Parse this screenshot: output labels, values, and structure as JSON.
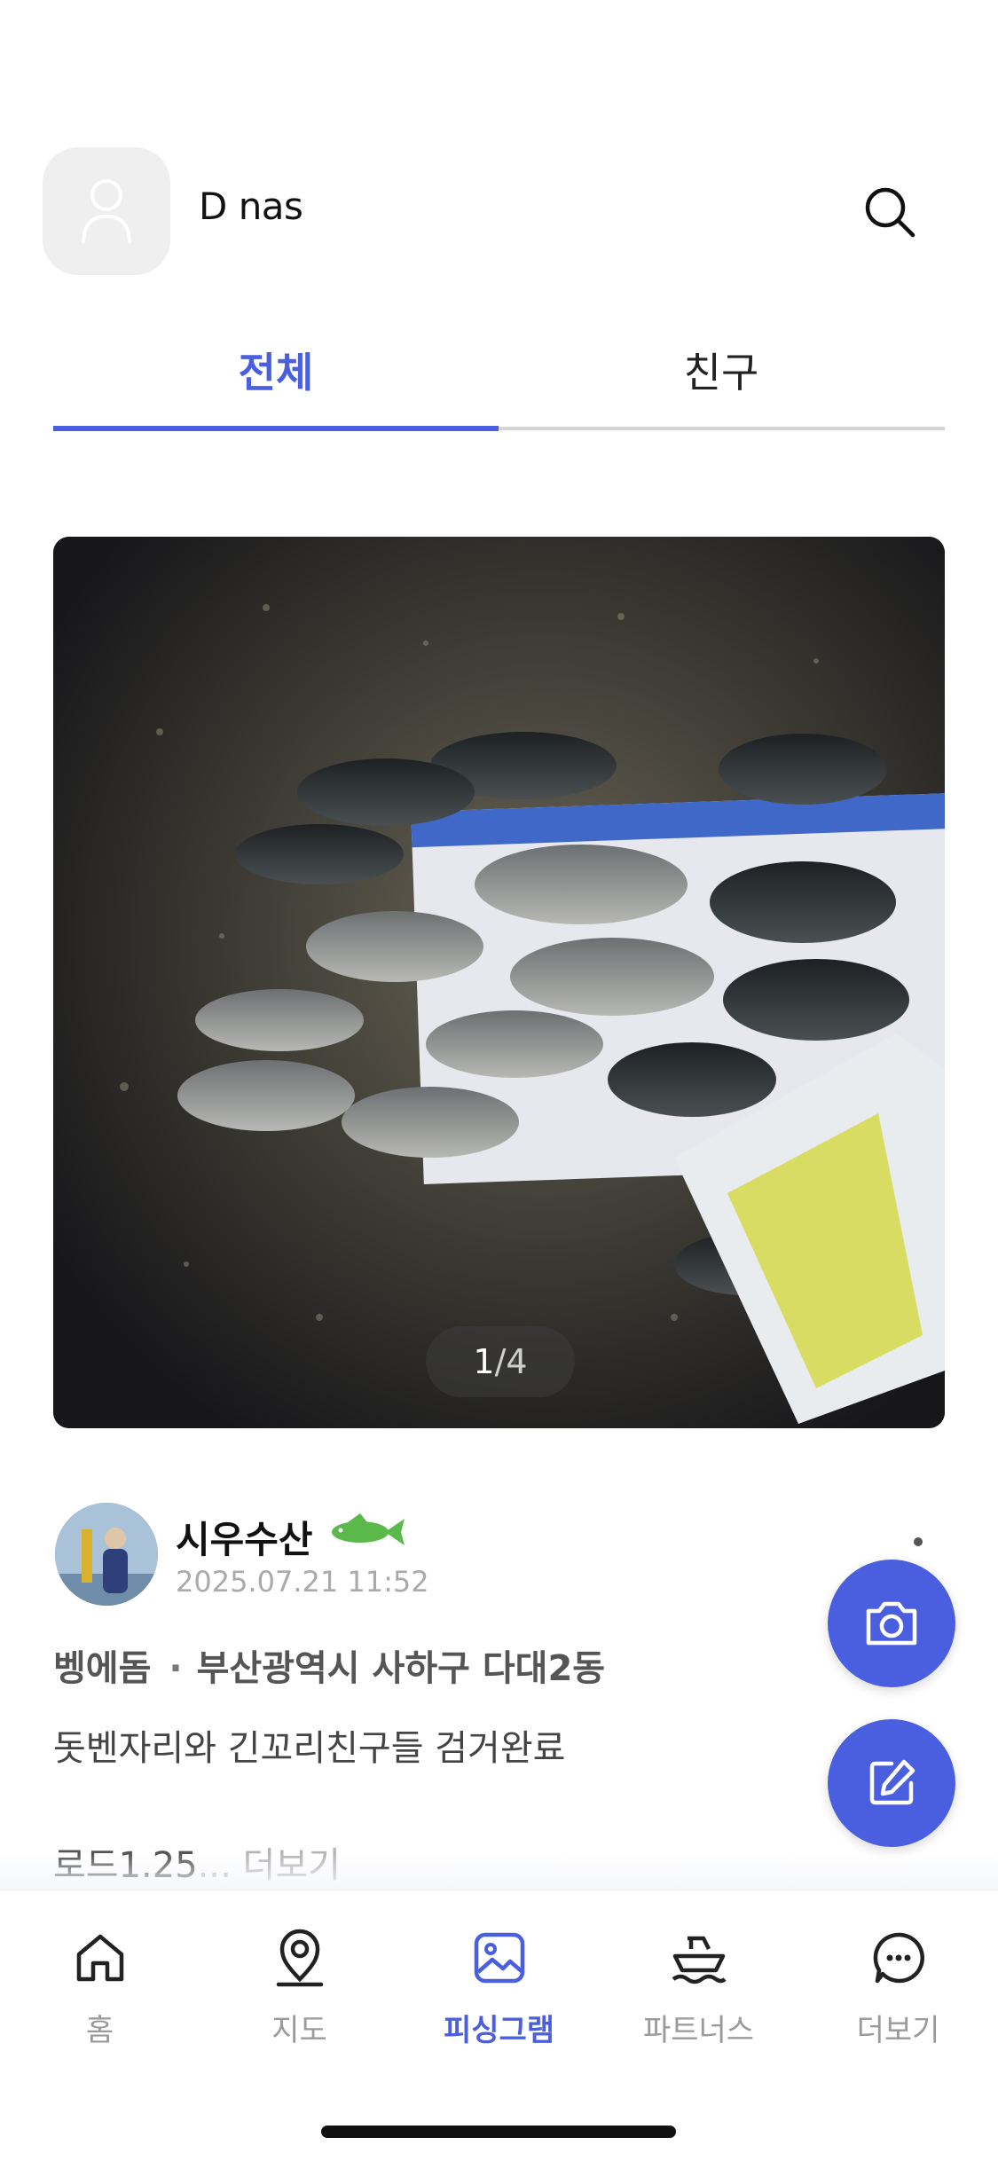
{
  "header": {
    "user_name": "D nas"
  },
  "tabs": [
    {
      "label": "전체",
      "active": true
    },
    {
      "label": "친구",
      "active": false
    }
  ],
  "post": {
    "image_counter": {
      "current": "1",
      "separator": "/",
      "total": "4"
    },
    "author": {
      "name": "시우수산",
      "time": "2025.07.21 11:52"
    },
    "species": "벵에돔",
    "location_separator": "·",
    "location": "부산광역시 사하구 다대2동",
    "caption": "돗벤자리와 긴꼬리친구들 검거완료",
    "caption_preview": "로드1.25",
    "ellipsis": "...",
    "more_label": "더보기"
  },
  "bottom_nav": [
    {
      "label": "홈",
      "icon": "home-icon",
      "active": false
    },
    {
      "label": "지도",
      "icon": "map-pin-icon",
      "active": false
    },
    {
      "label": "피싱그램",
      "icon": "image-icon",
      "active": true
    },
    {
      "label": "파트너스",
      "icon": "boat-icon",
      "active": false
    },
    {
      "label": "더보기",
      "icon": "chat-more-icon",
      "active": false
    }
  ],
  "colors": {
    "accent": "#4a5fe0",
    "badge_green": "#5bb84a",
    "inactive_gray": "#9a9a9a"
  }
}
